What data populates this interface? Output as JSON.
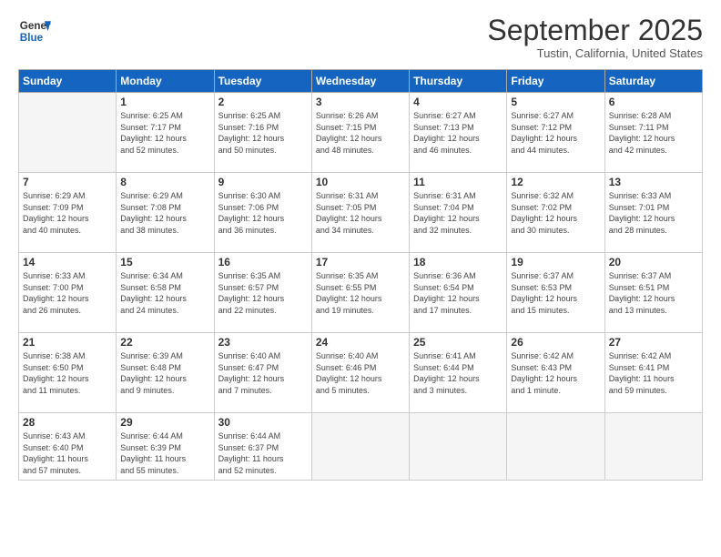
{
  "header": {
    "logo_general": "General",
    "logo_blue": "Blue",
    "month": "September 2025",
    "location": "Tustin, California, United States"
  },
  "weekdays": [
    "Sunday",
    "Monday",
    "Tuesday",
    "Wednesday",
    "Thursday",
    "Friday",
    "Saturday"
  ],
  "weeks": [
    [
      {
        "day": "",
        "info": ""
      },
      {
        "day": "1",
        "info": "Sunrise: 6:25 AM\nSunset: 7:17 PM\nDaylight: 12 hours\nand 52 minutes."
      },
      {
        "day": "2",
        "info": "Sunrise: 6:25 AM\nSunset: 7:16 PM\nDaylight: 12 hours\nand 50 minutes."
      },
      {
        "day": "3",
        "info": "Sunrise: 6:26 AM\nSunset: 7:15 PM\nDaylight: 12 hours\nand 48 minutes."
      },
      {
        "day": "4",
        "info": "Sunrise: 6:27 AM\nSunset: 7:13 PM\nDaylight: 12 hours\nand 46 minutes."
      },
      {
        "day": "5",
        "info": "Sunrise: 6:27 AM\nSunset: 7:12 PM\nDaylight: 12 hours\nand 44 minutes."
      },
      {
        "day": "6",
        "info": "Sunrise: 6:28 AM\nSunset: 7:11 PM\nDaylight: 12 hours\nand 42 minutes."
      }
    ],
    [
      {
        "day": "7",
        "info": "Sunrise: 6:29 AM\nSunset: 7:09 PM\nDaylight: 12 hours\nand 40 minutes."
      },
      {
        "day": "8",
        "info": "Sunrise: 6:29 AM\nSunset: 7:08 PM\nDaylight: 12 hours\nand 38 minutes."
      },
      {
        "day": "9",
        "info": "Sunrise: 6:30 AM\nSunset: 7:06 PM\nDaylight: 12 hours\nand 36 minutes."
      },
      {
        "day": "10",
        "info": "Sunrise: 6:31 AM\nSunset: 7:05 PM\nDaylight: 12 hours\nand 34 minutes."
      },
      {
        "day": "11",
        "info": "Sunrise: 6:31 AM\nSunset: 7:04 PM\nDaylight: 12 hours\nand 32 minutes."
      },
      {
        "day": "12",
        "info": "Sunrise: 6:32 AM\nSunset: 7:02 PM\nDaylight: 12 hours\nand 30 minutes."
      },
      {
        "day": "13",
        "info": "Sunrise: 6:33 AM\nSunset: 7:01 PM\nDaylight: 12 hours\nand 28 minutes."
      }
    ],
    [
      {
        "day": "14",
        "info": "Sunrise: 6:33 AM\nSunset: 7:00 PM\nDaylight: 12 hours\nand 26 minutes."
      },
      {
        "day": "15",
        "info": "Sunrise: 6:34 AM\nSunset: 6:58 PM\nDaylight: 12 hours\nand 24 minutes."
      },
      {
        "day": "16",
        "info": "Sunrise: 6:35 AM\nSunset: 6:57 PM\nDaylight: 12 hours\nand 22 minutes."
      },
      {
        "day": "17",
        "info": "Sunrise: 6:35 AM\nSunset: 6:55 PM\nDaylight: 12 hours\nand 19 minutes."
      },
      {
        "day": "18",
        "info": "Sunrise: 6:36 AM\nSunset: 6:54 PM\nDaylight: 12 hours\nand 17 minutes."
      },
      {
        "day": "19",
        "info": "Sunrise: 6:37 AM\nSunset: 6:53 PM\nDaylight: 12 hours\nand 15 minutes."
      },
      {
        "day": "20",
        "info": "Sunrise: 6:37 AM\nSunset: 6:51 PM\nDaylight: 12 hours\nand 13 minutes."
      }
    ],
    [
      {
        "day": "21",
        "info": "Sunrise: 6:38 AM\nSunset: 6:50 PM\nDaylight: 12 hours\nand 11 minutes."
      },
      {
        "day": "22",
        "info": "Sunrise: 6:39 AM\nSunset: 6:48 PM\nDaylight: 12 hours\nand 9 minutes."
      },
      {
        "day": "23",
        "info": "Sunrise: 6:40 AM\nSunset: 6:47 PM\nDaylight: 12 hours\nand 7 minutes."
      },
      {
        "day": "24",
        "info": "Sunrise: 6:40 AM\nSunset: 6:46 PM\nDaylight: 12 hours\nand 5 minutes."
      },
      {
        "day": "25",
        "info": "Sunrise: 6:41 AM\nSunset: 6:44 PM\nDaylight: 12 hours\nand 3 minutes."
      },
      {
        "day": "26",
        "info": "Sunrise: 6:42 AM\nSunset: 6:43 PM\nDaylight: 12 hours\nand 1 minute."
      },
      {
        "day": "27",
        "info": "Sunrise: 6:42 AM\nSunset: 6:41 PM\nDaylight: 11 hours\nand 59 minutes."
      }
    ],
    [
      {
        "day": "28",
        "info": "Sunrise: 6:43 AM\nSunset: 6:40 PM\nDaylight: 11 hours\nand 57 minutes."
      },
      {
        "day": "29",
        "info": "Sunrise: 6:44 AM\nSunset: 6:39 PM\nDaylight: 11 hours\nand 55 minutes."
      },
      {
        "day": "30",
        "info": "Sunrise: 6:44 AM\nSunset: 6:37 PM\nDaylight: 11 hours\nand 52 minutes."
      },
      {
        "day": "",
        "info": ""
      },
      {
        "day": "",
        "info": ""
      },
      {
        "day": "",
        "info": ""
      },
      {
        "day": "",
        "info": ""
      }
    ]
  ]
}
